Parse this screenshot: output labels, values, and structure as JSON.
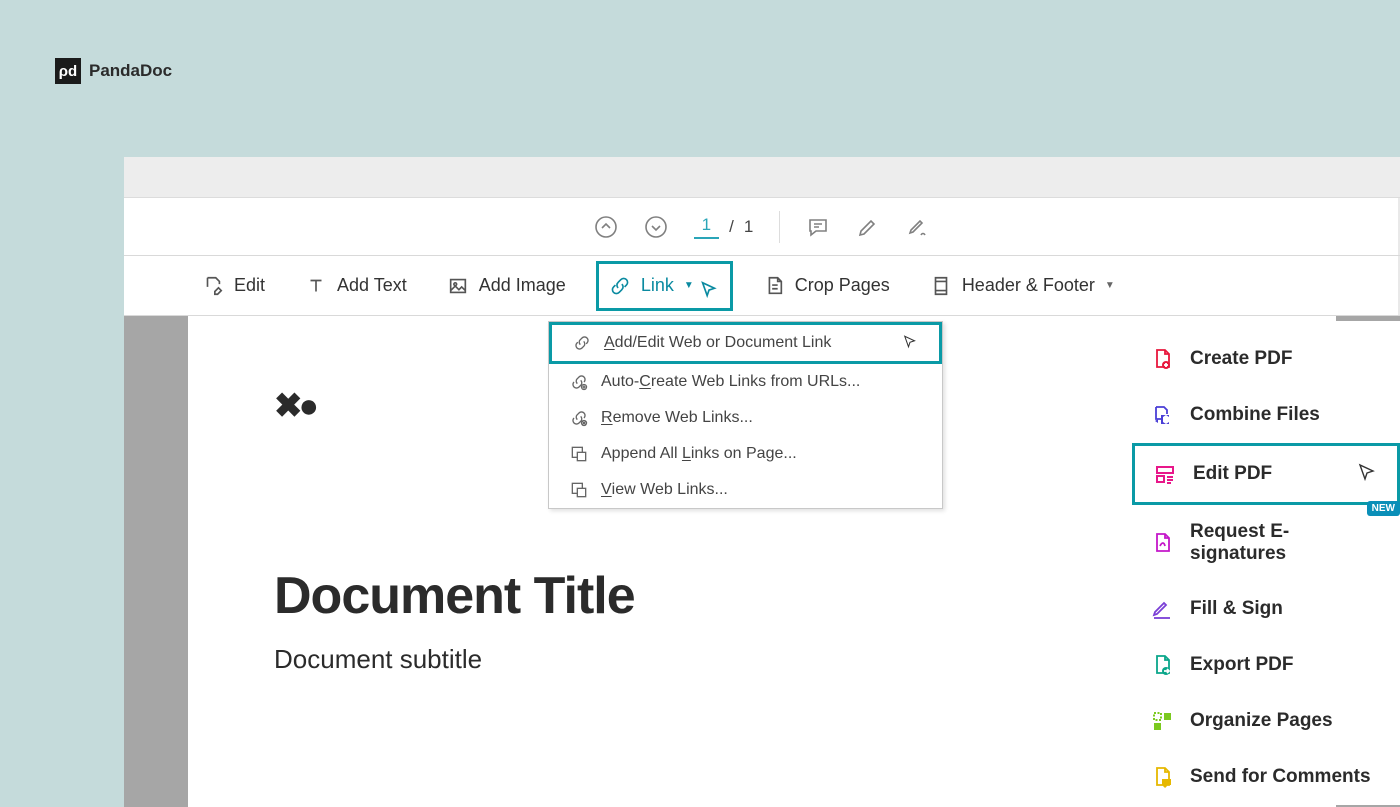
{
  "brand": {
    "name": "PandaDoc",
    "mark": "ρd"
  },
  "nav": {
    "current_page": "1",
    "page_sep": "/",
    "total_pages": "1"
  },
  "toolbar": {
    "edit": "Edit",
    "add_text": "Add Text",
    "add_image": "Add Image",
    "link": "Link",
    "crop_pages": "Crop Pages",
    "header_footer": "Header & Footer"
  },
  "link_menu": {
    "items": [
      {
        "label": "Add/Edit Web or Document Link"
      },
      {
        "label": "Auto-Create Web Links from URLs..."
      },
      {
        "label": "Remove Web Links..."
      },
      {
        "label": "Append All Links on Page..."
      },
      {
        "label": "View Web Links..."
      }
    ]
  },
  "document": {
    "title": "Document Title",
    "subtitle": "Document subtitle"
  },
  "sidebar": {
    "create_pdf": "Create PDF",
    "combine_files": "Combine Files",
    "edit_pdf": "Edit PDF",
    "request_esign": "Request E-signatures",
    "fill_sign": "Fill & Sign",
    "export_pdf": "Export PDF",
    "organize_pages": "Organize Pages",
    "send_comments": "Send for Comments",
    "new_badge": "NEW"
  }
}
